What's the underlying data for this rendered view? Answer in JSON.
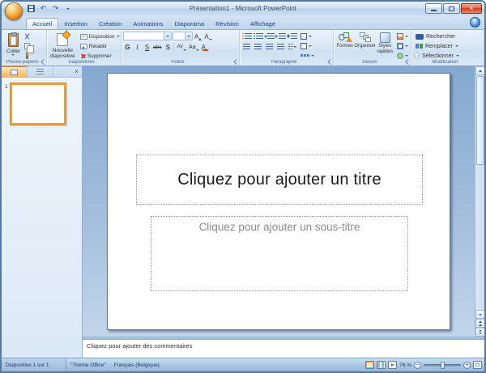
{
  "titlebar": {
    "title": "Présentation1 - Microsoft PowerPoint",
    "close_glyph": "×"
  },
  "qat": {
    "undo_glyph": "↶",
    "redo_glyph": "↷"
  },
  "tabs": {
    "items": [
      "Accueil",
      "Insertion",
      "Création",
      "Animations",
      "Diaporama",
      "Révision",
      "Affichage"
    ],
    "active_tab": "Accueil",
    "help_glyph": "?"
  },
  "ribbon": {
    "clipboard": {
      "group_label": "Presse-papiers",
      "paste": "Coller"
    },
    "slides": {
      "group_label": "Diapositives",
      "new_slide": "Nouvelle diapositive",
      "layout": "Disposition",
      "reset": "Rétablir",
      "delete": "Supprimer"
    },
    "font": {
      "group_label": "Police",
      "font_name_value": "",
      "font_size_value": "",
      "grow": "A",
      "shrink": "A",
      "bold": "G",
      "italic": "I",
      "underline": "S",
      "strikethrough": "abc",
      "shadow": "S",
      "spacing": "AV",
      "case": "Aa",
      "color": "A"
    },
    "paragraph": {
      "group_label": "Paragraphe"
    },
    "drawing": {
      "group_label": "Dessin",
      "shapes": "Formes",
      "arrange": "Organiser",
      "quick_styles": "Styles rapides"
    },
    "editing": {
      "group_label": "Modification",
      "find": "Rechercher",
      "replace": "Remplacer",
      "select": "Sélectionner"
    }
  },
  "slides_panel": {
    "slide_number": "1",
    "close_glyph": "×"
  },
  "slide": {
    "title_placeholder": "Cliquez pour ajouter un titre",
    "subtitle_placeholder": "Cliquez pour ajouter un sous-titre"
  },
  "notes": {
    "placeholder": "Cliquez pour ajouter des commentaires"
  },
  "statusbar": {
    "slide_counter": "Diapositive 1 sur 1",
    "theme": "\"Thème Office\"",
    "language": "Français (Belgique)",
    "zoom": "76 %",
    "zoom_out_glyph": "−",
    "zoom_in_glyph": "+"
  },
  "colors": {
    "selection_orange": "#f0a03c",
    "close_red": "#d2492f",
    "ribbon_text_blue": "#15428b",
    "workspace_blue": "#8fb0d4"
  }
}
